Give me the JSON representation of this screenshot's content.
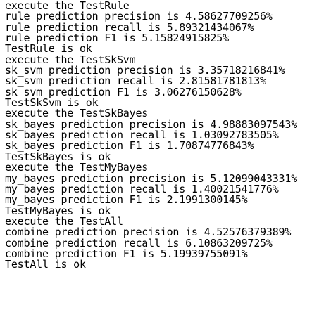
{
  "terminal": {
    "lines": [
      "execute the TestRule",
      "rule prediction precision is 4.58627709256%",
      "rule prediction recall is 5.89321434067%",
      "rule prediction F1 is 5.15824915825%",
      "TestRule is ok",
      "execute the TestSkSvm",
      "sk_svm prediction precision is 3.35718216841%",
      "sk_svm prediction recall is 2.81581781813%",
      "sk_svm prediction F1 is 3.06276150628%",
      "TestSkSvm is ok",
      "execute the TestSkBayes",
      "sk_bayes prediction precision is 4.98883097543%",
      "sk_bayes prediction recall is 1.03092783505%",
      "sk_bayes prediction F1 is 1.70874776843%",
      "TestSkBayes is ok",
      "execute the TestMyBayes",
      "my_bayes prediction precision is 5.12099043331%",
      "my_bayes prediction recall is 1.40021541776%",
      "my_bayes prediction F1 is 2.1991300145%",
      "TestMyBayes is ok",
      "execute the TestAll",
      "combine prediction precision is 4.52576379389%",
      "combine prediction recall is 6.10863209725%",
      "combine prediction F1 is 5.19939755091%",
      "TestAll is ok"
    ]
  }
}
